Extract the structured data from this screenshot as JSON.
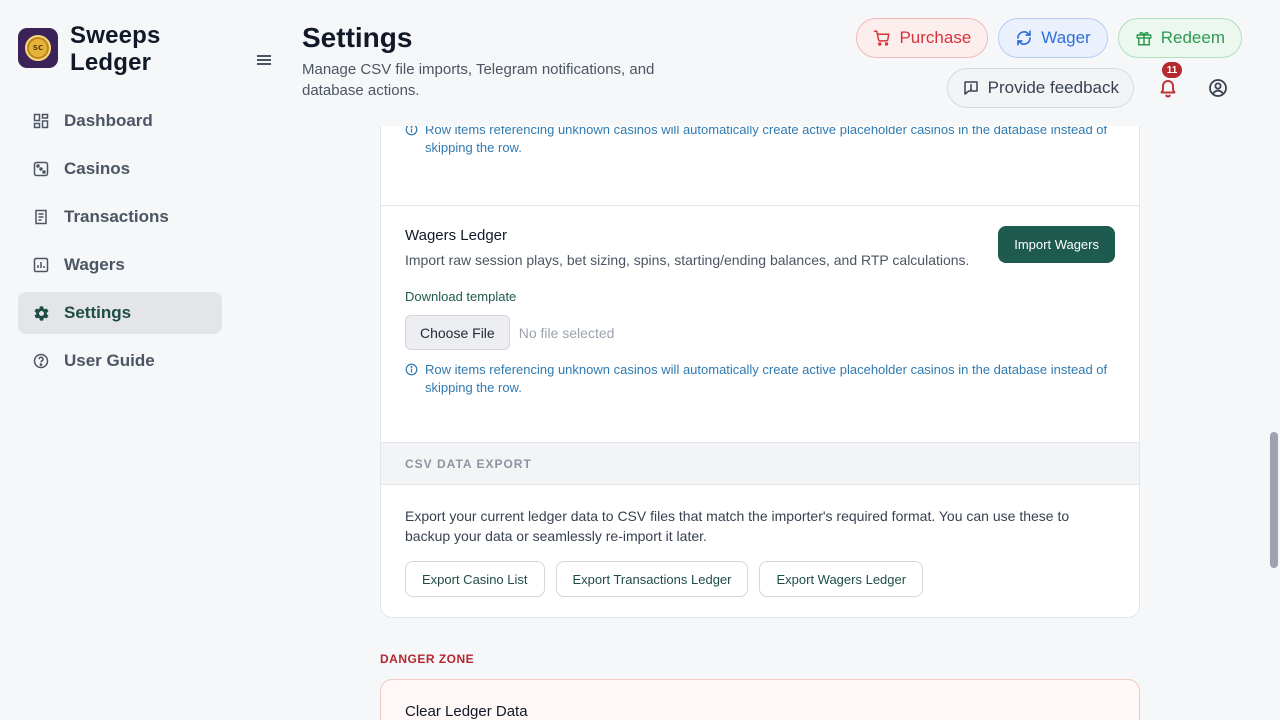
{
  "app": {
    "name": "Sweeps Ledger",
    "logo_text": "SC"
  },
  "sidebar": {
    "items": [
      {
        "label": "Dashboard",
        "icon": "dashboard-icon",
        "active": false
      },
      {
        "label": "Casinos",
        "icon": "dice-icon",
        "active": false
      },
      {
        "label": "Transactions",
        "icon": "receipt-icon",
        "active": false
      },
      {
        "label": "Wagers",
        "icon": "chart-icon",
        "active": false
      },
      {
        "label": "Settings",
        "icon": "gear-icon",
        "active": true
      },
      {
        "label": "User Guide",
        "icon": "help-circle-icon",
        "active": false
      }
    ]
  },
  "header": {
    "title": "Settings",
    "subtitle": "Manage CSV file imports, Telegram notifications, and database actions.",
    "actions": {
      "purchase": "Purchase",
      "wager": "Wager",
      "redeem": "Redeem"
    },
    "feedback": "Provide feedback",
    "notification_count": "11"
  },
  "import_section": {
    "note": "Row items referencing unknown casinos will automatically create active placeholder casinos in the database instead of skipping the row.",
    "wagers": {
      "title": "Wagers Ledger",
      "description": "Import raw session plays, bet sizing, spins, starting/ending balances, and RTP calculations.",
      "button": "Import Wagers",
      "template_link": "Download template",
      "choose_file": "Choose File",
      "no_file": "No file selected",
      "note": "Row items referencing unknown casinos will automatically create active placeholder casinos in the database instead of skipping the row."
    }
  },
  "export_section": {
    "heading": "CSV DATA EXPORT",
    "description": "Export your current ledger data to CSV files that match the importer's required format. You can use these to backup your data or seamlessly re-import it later.",
    "buttons": [
      "Export Casino List",
      "Export Transactions Ledger",
      "Export Wagers Ledger"
    ]
  },
  "danger_zone": {
    "label": "DANGER ZONE",
    "title": "Clear Ledger Data"
  },
  "colors": {
    "accent": "#1f5a4f",
    "purchase": "#d6343b",
    "wager": "#2f6fd6",
    "redeem": "#2f9a52",
    "danger": "#b5282e"
  }
}
